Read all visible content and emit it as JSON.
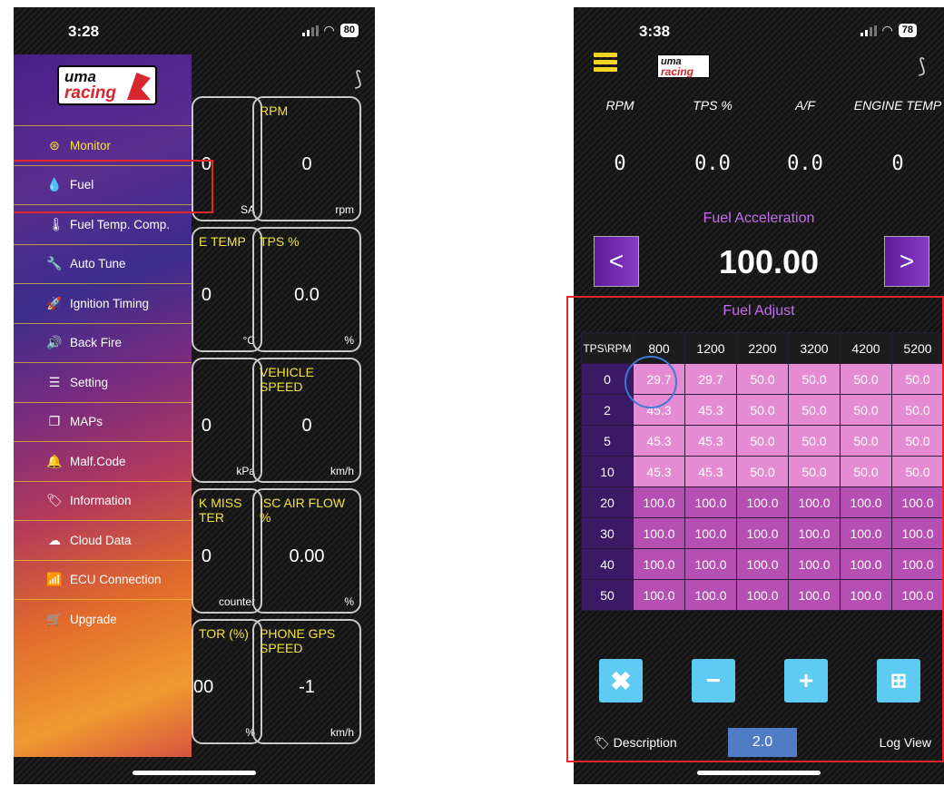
{
  "left": {
    "status": {
      "time": "3:28",
      "battery": "80"
    },
    "gauges": [
      {
        "title": "",
        "value": "0",
        "unit": "SA"
      },
      {
        "title": "RPM",
        "value": "0",
        "unit": "rpm"
      },
      {
        "title": "E TEMP",
        "value": "0",
        "unit": "°C"
      },
      {
        "title": "TPS %",
        "value": "0.0",
        "unit": "%"
      },
      {
        "title": "",
        "value": "0",
        "unit": "kPa"
      },
      {
        "title": "VEHICLE SPEED",
        "value": "0",
        "unit": "km/h"
      },
      {
        "title": "K MISS TER",
        "value": "0",
        "unit": "counter"
      },
      {
        "title": "ISC AIR FLOW %",
        "value": "0.00",
        "unit": "%"
      },
      {
        "title": "TOR (%)",
        "value": "00",
        "unit": "%"
      },
      {
        "title": "PHONE GPS SPEED",
        "value": "-1",
        "unit": "km/h"
      }
    ],
    "logo": {
      "line1": "uma",
      "line2": "racing"
    },
    "menu": [
      {
        "label": "Monitor",
        "icon": "steering-wheel-icon",
        "glyph": "⊛"
      },
      {
        "label": "Fuel",
        "icon": "fuel-drops-icon",
        "glyph": "💧"
      },
      {
        "label": "Fuel Temp. Comp.",
        "icon": "thermometer-icon",
        "glyph": "🌡"
      },
      {
        "label": "Auto Tune",
        "icon": "wrench-icon",
        "glyph": "🔧"
      },
      {
        "label": "Ignition Timing",
        "icon": "rocket-icon",
        "glyph": "🚀"
      },
      {
        "label": "Back Fire",
        "icon": "speaker-icon",
        "glyph": "🔊"
      },
      {
        "label": "Setting",
        "icon": "sliders-icon",
        "glyph": "☰"
      },
      {
        "label": "MAPs",
        "icon": "copy-icon",
        "glyph": "❐"
      },
      {
        "label": "Malf.Code",
        "icon": "bell-icon",
        "glyph": "🔔"
      },
      {
        "label": "Information",
        "icon": "tags-icon",
        "glyph": "🏷"
      },
      {
        "label": "Cloud Data",
        "icon": "cloud-download-icon",
        "glyph": "☁"
      },
      {
        "label": "ECU Connection",
        "icon": "wifi-icon",
        "glyph": "📶"
      },
      {
        "label": "Upgrade",
        "icon": "cart-icon",
        "glyph": "🛒"
      }
    ]
  },
  "right": {
    "status": {
      "time": "3:38",
      "battery": "78"
    },
    "logo": {
      "line1": "uma",
      "line2": "racing"
    },
    "readout_labels": [
      "RPM",
      "TPS %",
      "A/F",
      "ENGINE TEMP"
    ],
    "readout_values": [
      "0",
      "0.0",
      "0.0",
      "0"
    ],
    "fuel_accel_title": "Fuel Acceleration",
    "fuel_accel_value": "100.00",
    "prev_label": "<",
    "next_label": ">",
    "fuel_adjust_title": "Fuel Adjust",
    "table": {
      "corner": "TPS\\RPM",
      "columns": [
        "800",
        "1200",
        "2200",
        "3200",
        "4200",
        "5200"
      ],
      "rows": [
        {
          "tps": "0",
          "cells": [
            "29.7",
            "29.7",
            "50.0",
            "50.0",
            "50.0",
            "50.0"
          ]
        },
        {
          "tps": "2",
          "cells": [
            "45.3",
            "45.3",
            "50.0",
            "50.0",
            "50.0",
            "50.0"
          ]
        },
        {
          "tps": "5",
          "cells": [
            "45.3",
            "45.3",
            "50.0",
            "50.0",
            "50.0",
            "50.0"
          ]
        },
        {
          "tps": "10",
          "cells": [
            "45.3",
            "45.3",
            "50.0",
            "50.0",
            "50.0",
            "50.0"
          ]
        },
        {
          "tps": "20",
          "cells": [
            "100.0",
            "100.0",
            "100.0",
            "100.0",
            "100.0",
            "100.0"
          ]
        },
        {
          "tps": "30",
          "cells": [
            "100.0",
            "100.0",
            "100.0",
            "100.0",
            "100.0",
            "100.0"
          ]
        },
        {
          "tps": "40",
          "cells": [
            "100.0",
            "100.0",
            "100.0",
            "100.0",
            "100.0",
            "100.0"
          ]
        },
        {
          "tps": "50",
          "cells": [
            "100.0",
            "100.0",
            "100.0",
            "100.0",
            "100.0",
            "100.0"
          ]
        }
      ]
    },
    "toolbar": {
      "clear": "✖",
      "minus": "−",
      "plus": "+",
      "grid": "⊞"
    },
    "description_label": "Description",
    "step_value": "2.0",
    "log_view_label": "Log View"
  }
}
